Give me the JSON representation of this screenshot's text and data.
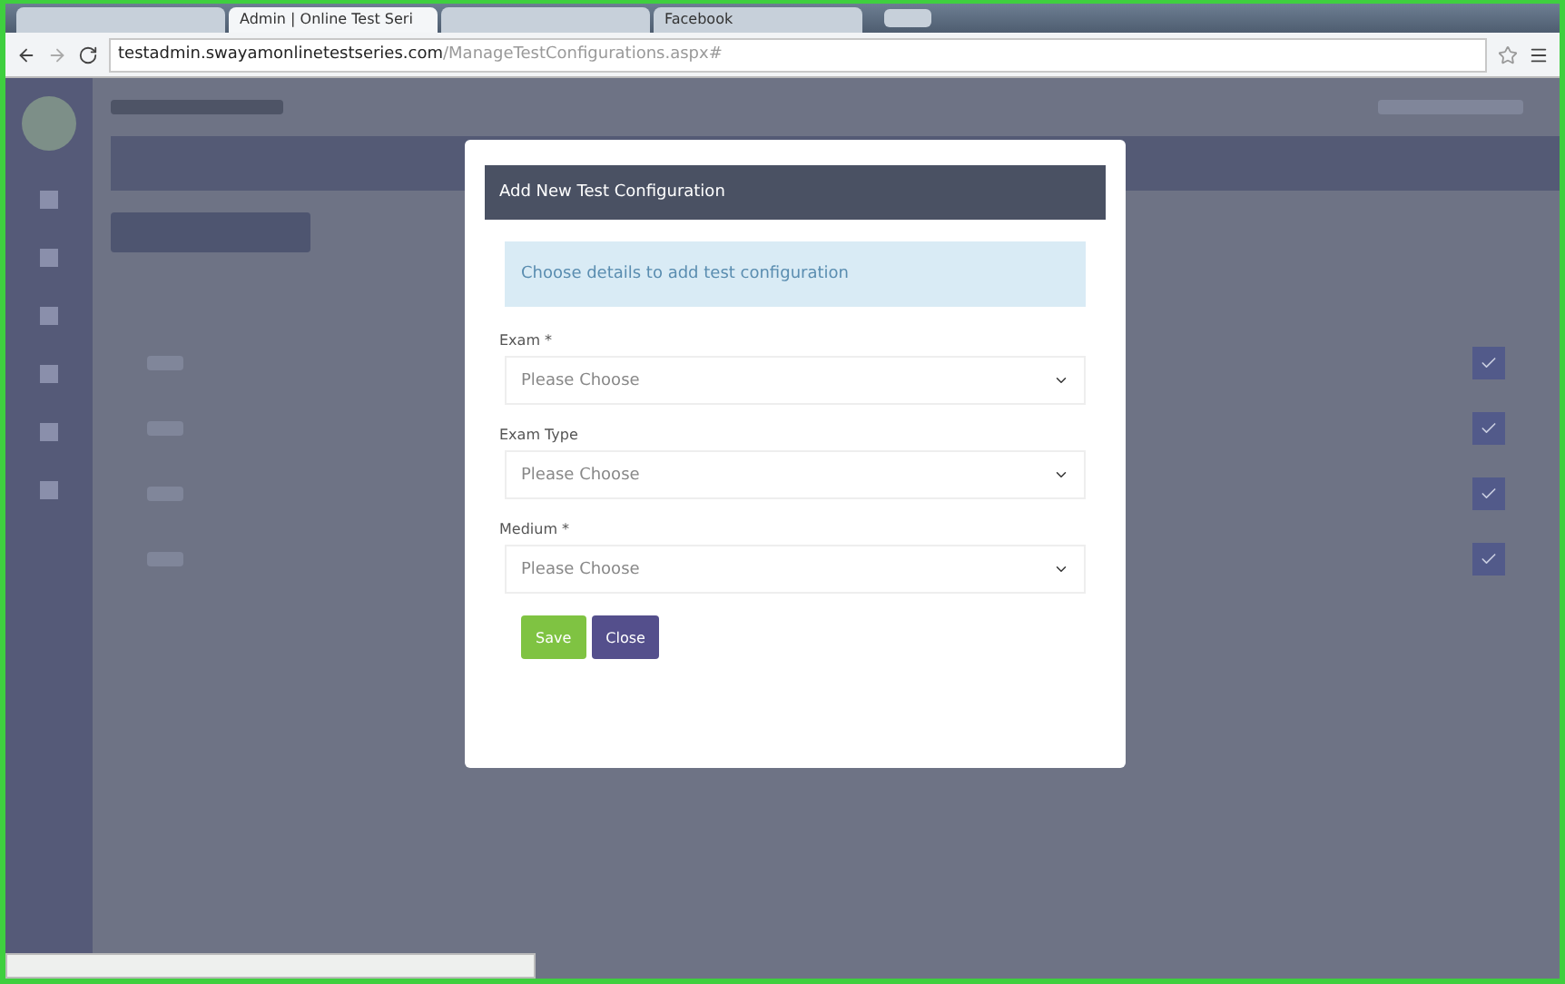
{
  "browser": {
    "tabs": [
      {
        "selected": false
      },
      {
        "title": "Admin | Online Test Seri",
        "selected": true
      },
      {
        "selected": false
      },
      {
        "title": "Facebook",
        "selected": false
      }
    ],
    "url_host": "testadmin.swayamonlinetestseries.com",
    "url_path": "/ManageTestConfigurations.aspx#"
  },
  "page": {
    "table_rows": [
      {
        "checked": true
      },
      {
        "checked": true
      },
      {
        "checked": true
      },
      {
        "checked": true
      }
    ]
  },
  "modal": {
    "title": "Add New Test Configuration",
    "info": "Choose details to add test configuration",
    "fields": [
      {
        "label": "Exam *",
        "placeholder": "Please Choose"
      },
      {
        "label": "Exam Type",
        "placeholder": "Please Choose"
      },
      {
        "label": "Medium *",
        "placeholder": "Please Choose"
      }
    ],
    "buttons": [
      {
        "label": "Save",
        "kind": "primary"
      },
      {
        "label": "Close",
        "kind": "secondary"
      }
    ]
  }
}
